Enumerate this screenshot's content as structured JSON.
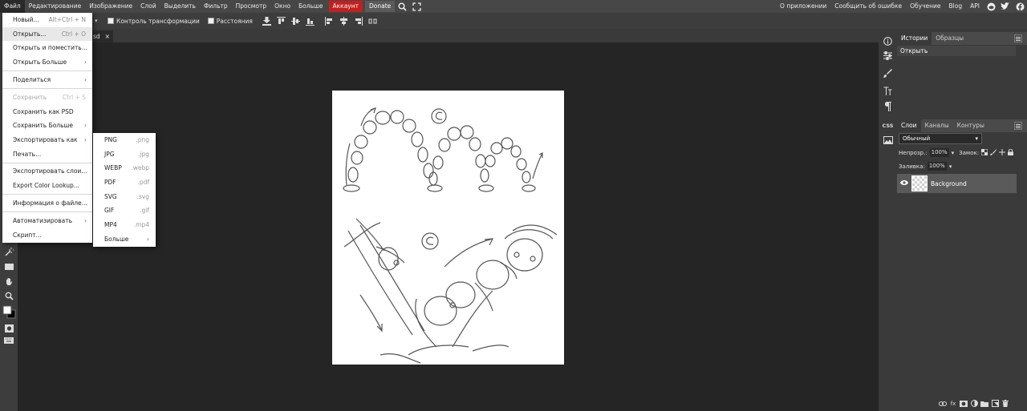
{
  "menubar": {
    "items": [
      "Файл",
      "Редактирование",
      "Изображение",
      "Слой",
      "Выделить",
      "Фильтр",
      "Просмотр",
      "Окно",
      "Больше"
    ],
    "account": "Аккаунт",
    "donate": "Donate",
    "right_links": [
      "О приложении",
      "Сообщить об ошибке",
      "Обучение",
      "Blog",
      "API"
    ],
    "icons": [
      "search-icon",
      "fullscreen-icon",
      "reddit-icon",
      "twitter-icon",
      "facebook-icon"
    ]
  },
  "optbar": {
    "transform_label": "Контроль трансформации",
    "distances_label": "Расстояния"
  },
  "document_tab": {
    "name": "sd",
    "close": "×"
  },
  "file_menu": {
    "items": [
      {
        "label": "Новый...",
        "shortcut": "Alt+Ctrl + N"
      },
      {
        "label": "Открыть...",
        "shortcut": "Ctrl + O"
      },
      {
        "label": "Открыть и поместить..."
      },
      {
        "label": "Открыть Больше",
        "arrow": "›"
      },
      {
        "label": "Поделиться",
        "arrow": "›"
      },
      {
        "label": "Сохранить",
        "shortcut": "Ctrl + S",
        "disabled": true
      },
      {
        "label": "Сохранить как PSD"
      },
      {
        "label": "Сохранить Больше",
        "arrow": "›"
      },
      {
        "label": "Экспортировать как",
        "arrow": "›"
      },
      {
        "label": "Печать..."
      },
      {
        "label": "Экспортировать слои..."
      },
      {
        "label": "Export Color Lookup..."
      },
      {
        "label": "Информация о файле..."
      },
      {
        "label": "Автоматизировать",
        "arrow": "›"
      },
      {
        "label": "Скрипт..."
      }
    ]
  },
  "export_menu": {
    "items": [
      {
        "label": "PNG",
        "ext": ".png"
      },
      {
        "label": "JPG",
        "ext": ".jpg"
      },
      {
        "label": "WEBP",
        "ext": ".webp"
      },
      {
        "label": "PDF",
        "ext": ".pdf"
      },
      {
        "label": "SVG",
        "ext": ".svg"
      },
      {
        "label": "GIF",
        "ext": ".gif"
      },
      {
        "label": "MP4",
        "ext": ".mp4"
      },
      {
        "label": "Больше",
        "arrow": "›"
      }
    ]
  },
  "history_panel": {
    "tabs": [
      "Истории",
      "Образцы"
    ],
    "items": [
      "Открыть"
    ]
  },
  "layers_panel": {
    "tabs": [
      "Слои",
      "Каналы",
      "Контуры"
    ],
    "blend_mode": "Обычный",
    "opacity_label": "Непрозр.:",
    "opacity_value": "100%",
    "lock_label": "Замок:",
    "fill_label": "Заливка:",
    "fill_value": "100%",
    "layers": [
      {
        "name": "Background",
        "visible": true
      }
    ],
    "bottom_buttons": [
      "link-icon",
      "fx",
      "mask-icon",
      "adjustment-icon",
      "folder-icon",
      "new-layer-icon",
      "delete-icon"
    ]
  },
  "rightbar": {
    "css_label": "CSS"
  },
  "colors": {
    "accent_account": "#c31f1f",
    "menubar": "#474747",
    "background": "#252525"
  }
}
